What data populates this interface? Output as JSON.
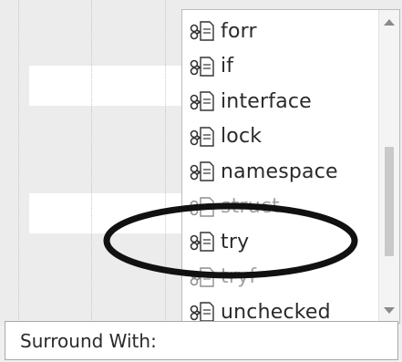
{
  "snippet_list": {
    "items": [
      {
        "label": "forr",
        "icon": "snippet-icon"
      },
      {
        "label": "if",
        "icon": "snippet-icon"
      },
      {
        "label": "interface",
        "icon": "snippet-icon"
      },
      {
        "label": "lock",
        "icon": "snippet-icon"
      },
      {
        "label": "namespace",
        "icon": "snippet-icon"
      },
      {
        "label": "struct",
        "icon": "snippet-icon"
      },
      {
        "label": "try",
        "icon": "snippet-icon"
      },
      {
        "label": "tryf",
        "icon": "snippet-icon"
      },
      {
        "label": "unchecked",
        "icon": "snippet-icon"
      }
    ],
    "highlighted_item": "try"
  },
  "prompt": {
    "label": "Surround With:",
    "value": ""
  },
  "colors": {
    "annotation_ellipse": "#111111",
    "list_background": "#ffffff",
    "editor_background": "#ececec"
  }
}
